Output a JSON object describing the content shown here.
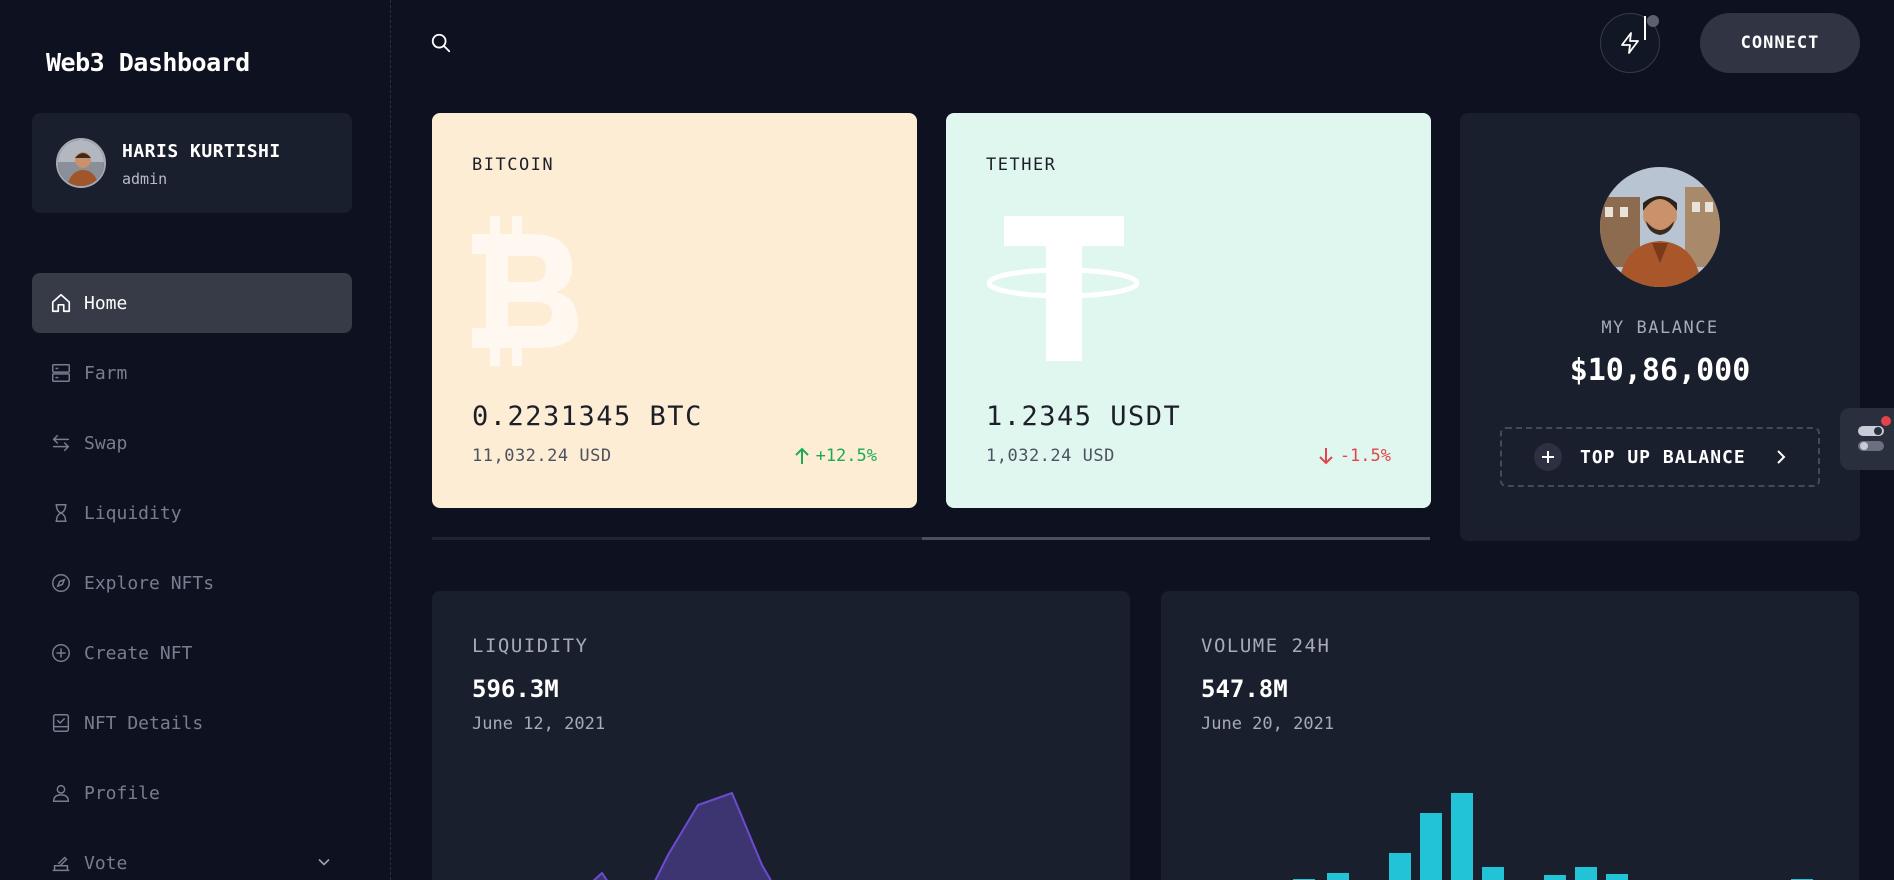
{
  "sidebar": {
    "brand": "Web3 Dashboard",
    "user": {
      "name": "HARIS KURTISHI",
      "role": "admin"
    },
    "items": [
      {
        "label": "Home",
        "icon": "home-icon",
        "active": true
      },
      {
        "label": "Farm",
        "icon": "server-icon"
      },
      {
        "label": "Swap",
        "icon": "swap-arrows-icon"
      },
      {
        "label": "Liquidity",
        "icon": "hourglass-icon"
      },
      {
        "label": "Explore NFTs",
        "icon": "compass-icon"
      },
      {
        "label": "Create NFT",
        "icon": "plus-circle-icon"
      },
      {
        "label": "NFT Details",
        "icon": "checklist-icon"
      },
      {
        "label": "Profile",
        "icon": "user-icon"
      },
      {
        "label": "Vote",
        "icon": "vote-icon"
      }
    ]
  },
  "header": {
    "connect_label": "CONNECT",
    "search_icon": "search-icon",
    "bolt_icon": "lightning-icon"
  },
  "coins": [
    {
      "name": "BITCOIN",
      "amount": "0.2231345 BTC",
      "usd": "11,032.24 USD",
      "change": "+12.5%",
      "direction": "up",
      "bg": "#fdedd5"
    },
    {
      "name": "TETHER",
      "amount": "1.2345 USDT",
      "usd": "1,032.24 USD",
      "change": "-1.5%",
      "direction": "down",
      "bg": "#e0f7ef"
    }
  ],
  "carousel": {
    "position": 0.5
  },
  "balance": {
    "label": "MY BALANCE",
    "value": "$10,86,000",
    "topup_label": "TOP UP BALANCE"
  },
  "stats": {
    "liquidity": {
      "label": "LIQUIDITY",
      "value": "596.3M",
      "date": "June 12, 2021"
    },
    "volume": {
      "label": "VOLUME 24H",
      "value": "547.8M",
      "date": "June 20, 2021"
    }
  },
  "colors": {
    "background": "#0e1220",
    "card": "#1a1f2e",
    "area_stroke": "#6d4bd0",
    "area_fill": "#3a3470",
    "bar": "#22c3d6",
    "up": "#1eaa55",
    "down": "#e2444c"
  }
}
